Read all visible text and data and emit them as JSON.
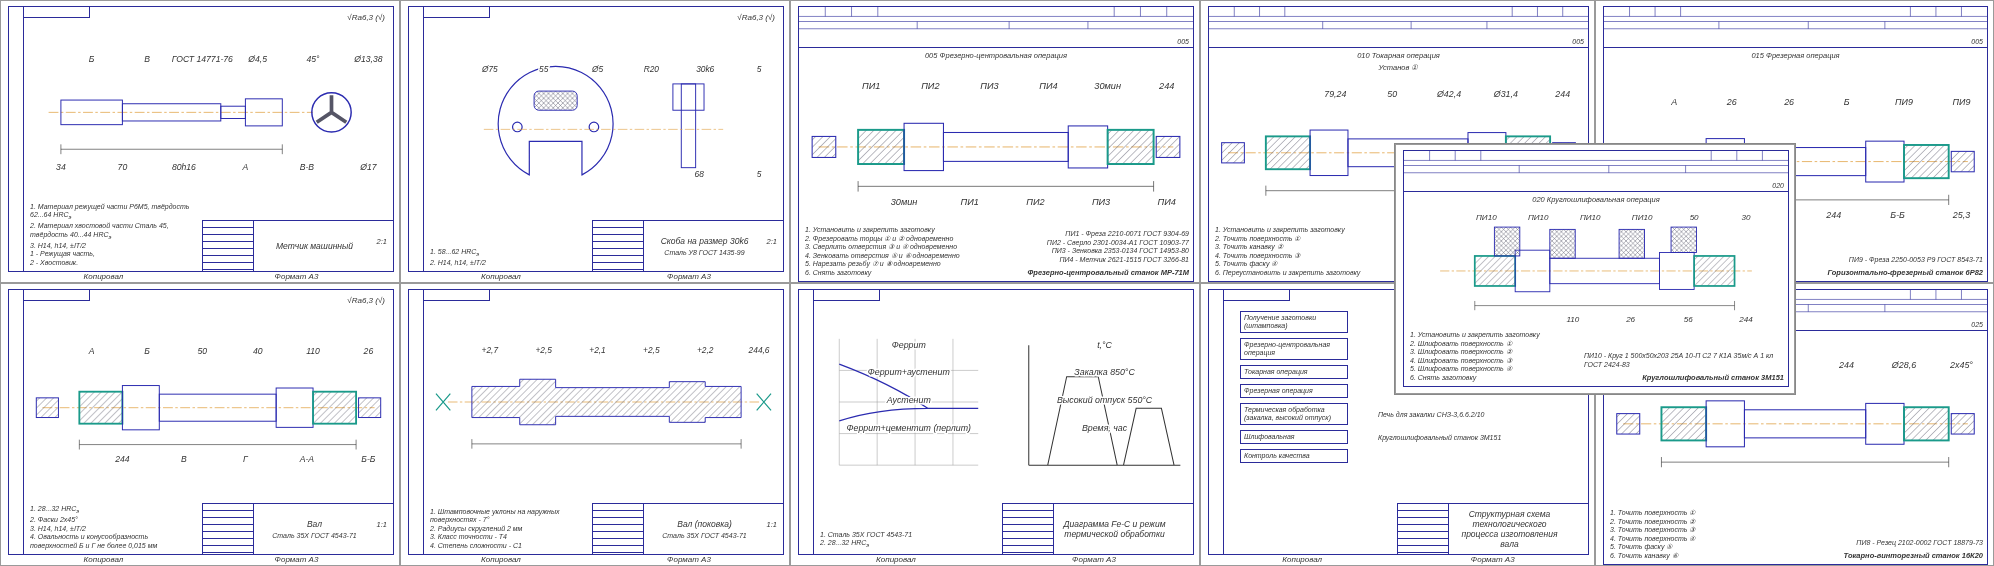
{
  "sheets": [
    {
      "kind": "tap",
      "roughness": "√Ra6,3 (√)",
      "labels": [
        "Б",
        "В",
        "ГОСТ 14771-76",
        "Ø4,5",
        "45°",
        "Ø13,38",
        "34",
        "70",
        "80h16",
        "А",
        "В-В",
        "Ø17"
      ],
      "notes": [
        "1. Материал режущей части Р6М5, твёрдость 62...64 HRC$_{э}$",
        "2. Материал хвостовой части Сталь 45, твёрдость 40...44 HRC$_{э}$",
        "3. H14, h14, ±IT/2"
      ],
      "legend": [
        "1 - Режущая часть,",
        "2 - Хвостовик."
      ],
      "title_block": {
        "name": "Метчик машинный",
        "scale": "2:1"
      },
      "footer": [
        "Копировал",
        "Формат А3"
      ]
    },
    {
      "kind": "gauge",
      "roughness": "√Ra6,3 (√)",
      "labels": [
        "Ø75",
        "55",
        "Ø5",
        "R20",
        "30k6",
        "5",
        "68",
        "5"
      ],
      "notes": [
        "1. 58...62 HRC$_{э}$",
        "2. H14, h14, ±IT/2"
      ],
      "title_block": {
        "name": "Скоба на размер 30k6",
        "material": "Сталь У8 ГОСТ 1435-99",
        "scale": "2:1"
      },
      "footer": [
        "Копировал",
        "Формат А3"
      ]
    },
    {
      "kind": "shaft-operation",
      "op_number": "005",
      "heading": "005 Фрезерно-центровальная операция",
      "labels": [
        "ПИ1",
        "ПИ2",
        "ПИ3",
        "ПИ4",
        "30мин",
        "244",
        "30мин",
        "ПИ1",
        "ПИ2",
        "ПИ3",
        "ПИ4"
      ],
      "steps": [
        "1. Установить и закрепить заготовку",
        "2. Фрезеровать торцы ① и ② одновременно",
        "3. Сверлить отверстия ③ и ④ одновременно",
        "4. Зенковать отверстия ⑤ и ⑥ одновременно",
        "5. Нарезать резьбу ⑦ и ⑧ одновременно",
        "6. Снять заготовку"
      ],
      "tools": [
        "ПИ1 - Фреза 2210-0071 ГОСТ 9304-69",
        "ПИ2 - Сверло 2301-0034-А1 ГОСТ 10903-77",
        "ПИ3 - Зенковка 2353-0134 ГОСТ 14953-80",
        "ПИ4 - Метчик 2621-1515 ГОСТ 3266-81"
      ],
      "machine": "Фрезерно-центровальный станок МР-71М"
    },
    {
      "kind": "shaft-operation",
      "op_number": "005",
      "heading": "010 Токарная операция",
      "setup": "Установ ①",
      "labels": [
        "79,24",
        "50",
        "Ø42,4",
        "Ø31,4",
        "244"
      ],
      "steps": [
        "1. Установить и закрепить заготовку",
        "2. Точить поверхность ①",
        "3. Точить канавку ②",
        "4. Точить поверхность ③",
        "5. Точить фаску ④",
        "6. Переустановить и закрепить заготовку"
      ]
    },
    {
      "kind": "shaft-operation",
      "op_number": "005",
      "heading": "015 Фрезерная операция",
      "labels": [
        "А",
        "26",
        "26",
        "Б",
        "ПИ9",
        "ПИ9",
        "244",
        "Б-Б",
        "25,3"
      ],
      "tools": [
        "ПИ9 - Фреза 2250-0053 Р9 ГОСТ 8543-71"
      ],
      "machine": "Горизонтально-фрезерный станок 6Р82"
    },
    {
      "kind": "shaft",
      "roughness": "√Ra6,3 (√)",
      "labels": [
        "А",
        "Б",
        "50",
        "40",
        "110",
        "26",
        "244",
        "В",
        "Г",
        "А-А",
        "Б-Б"
      ],
      "notes": [
        "1. 28...32 HRC$_{э}$",
        "2. Фаски 2х45°",
        "3. H14, h14, ±IT/2",
        "4. Овальность и конусообразность поверхностей Б и Г не более 0,015 мм"
      ],
      "title_block": {
        "name": "Вал",
        "material": "Сталь 35Х ГОСТ 4543-71",
        "scale": "1:1"
      },
      "footer": [
        "Копировал",
        "Формат А3"
      ]
    },
    {
      "kind": "forging",
      "labels": [
        "+2,7",
        "+2,5",
        "+2,1",
        "+2,5",
        "+2,2",
        "244,6"
      ],
      "notes": [
        "1. Штамповочные уклоны на наружных поверхностях - 7°",
        "2. Радиусы скруглений 2 мм",
        "3. Класс точности - Т4",
        "4. Степень сложности - С1"
      ],
      "title_block": {
        "name": "Вал (поковка)",
        "material": "Сталь 35Х ГОСТ 4543-71",
        "scale": "1:1"
      },
      "footer": [
        "Копировал",
        "Формат А3"
      ]
    },
    {
      "kind": "diagram",
      "labels": [
        "Феррит",
        "Феррит+аустенит",
        "Аустенит",
        "Феррит+цементит (перлит)",
        "t,°C",
        "Закалка 850°С",
        "Высокий отпуск 550°С",
        "Время, час"
      ],
      "notes": [
        "1. Сталь 35Х ГОСТ 4543-71",
        "2. 28...32 HRC$_{э}$"
      ],
      "title_block": {
        "name": "Диаграмма Fe-C и режим термической обработки"
      },
      "footer": [
        "Копировал",
        "Формат А3"
      ]
    },
    {
      "kind": "flowchart",
      "stages": [
        {
          "name": "Получение заготовки (штамповка)"
        },
        {
          "name": "Фрезерно-центровальная операция"
        },
        {
          "name": "Токарная операция"
        },
        {
          "name": "Фрезерная операция"
        },
        {
          "name": "Термическая обработка (закалка, высокий отпуск)",
          "machine": "Печь для закалки СНЗ-3,6.6.2/10"
        },
        {
          "name": "Шлифовальная",
          "machine": "Круглошлифовальный станок 3М151"
        },
        {
          "name": "Контроль качества"
        }
      ],
      "title_block": {
        "name": "Структурная схема технологического процесса изготовления вала"
      },
      "footer": [
        "Копировал",
        "Формат А3"
      ]
    },
    {
      "kind": "shaft-operation",
      "op_number": "025",
      "labels": [
        "244",
        "Ø28,6",
        "2х45°"
      ],
      "steps": [
        "1. Точить поверхность ①",
        "2. Точить поверхность ②",
        "3. Точить поверхность ③",
        "4. Точить поверхность ④",
        "5. Точить фаску ⑤",
        "6. Точить канавку ⑥"
      ],
      "tools": [
        "ПИ8 - Резец 2102-0002 ГОСТ 18879-73"
      ],
      "machine": "Токарно-винторезный станок 16К20"
    }
  ],
  "front_sheet": {
    "kind": "grinding-operation",
    "op_number": "020",
    "heading": "020 Круглошлифовальная операция",
    "labels": [
      "ПИ10",
      "ПИ10",
      "ПИ10",
      "ПИ10",
      "50",
      "30",
      "110",
      "26",
      "56",
      "244"
    ],
    "steps": [
      "1. Установить и закрепить заготовку",
      "2. Шлифовать поверхность ①",
      "3. Шлифовать поверхность ②",
      "4. Шлифовать поверхность ③",
      "5. Шлифовать поверхность ④",
      "6. Снять заготовку"
    ],
    "tools": [
      "ПИ10 - Круг 1 500х50х203 25А 10-П С2 7 К1А 35м/с А 1 кл ГОСТ 2424-83"
    ],
    "machine": "Круглошлифовальный станок 3М151"
  }
}
